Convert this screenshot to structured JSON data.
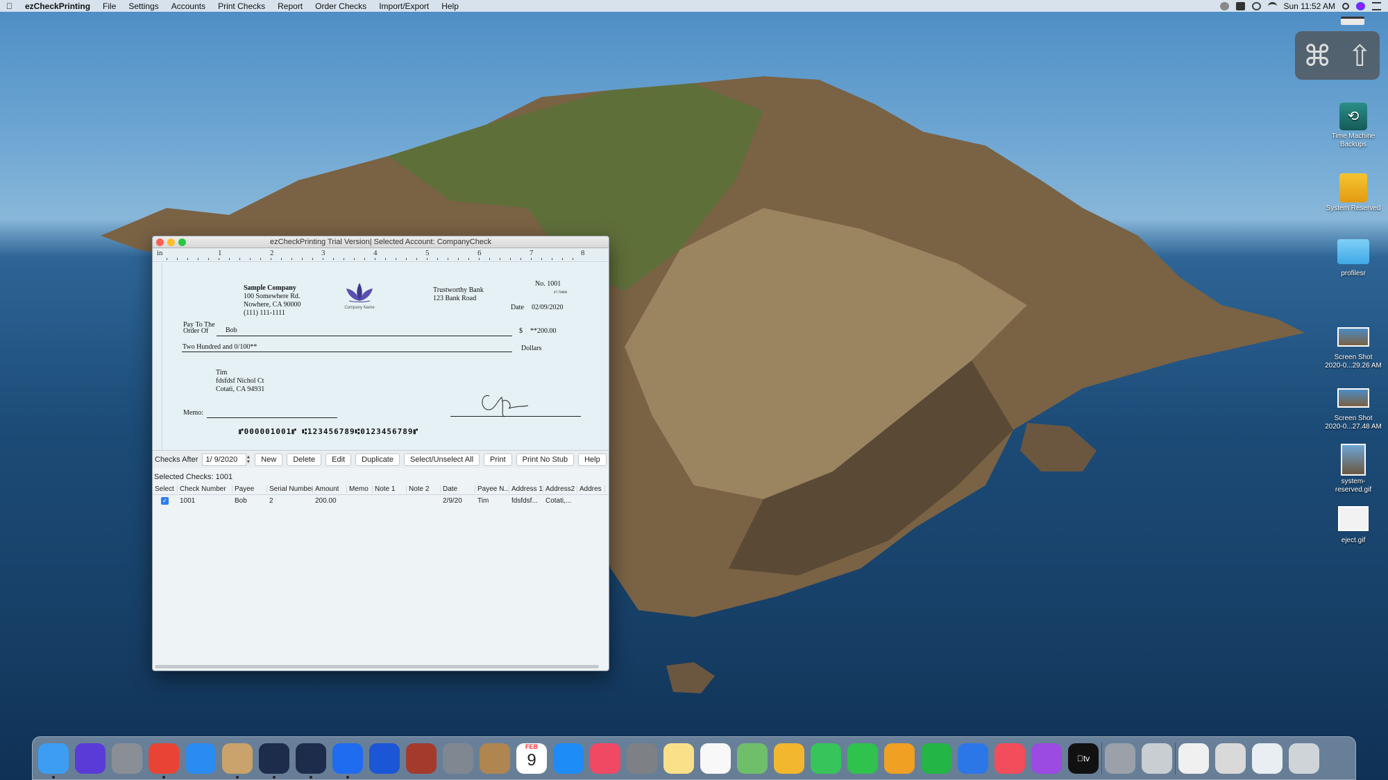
{
  "menubar": {
    "app": "ezCheckPrinting",
    "items": [
      "File",
      "Settings",
      "Accounts",
      "Print Checks",
      "Report",
      "Order Checks",
      "Import/Export",
      "Help"
    ],
    "clock": "Sun 11:52 AM"
  },
  "window": {
    "title": "ezCheckPrinting Trial Version| Selected Account: CompanyCheck",
    "ruler": {
      "unit": "in",
      "marks": [
        "1",
        "2",
        "3",
        "4",
        "5",
        "6",
        "7",
        "8"
      ]
    },
    "check": {
      "company_name": "Sample Company",
      "company_addr1": "100 Somewhere Rd.",
      "company_addr2": "Nowhere, CA 90000",
      "company_phone": "(111) 111-1111",
      "logo_text": "Company Name",
      "bank_name": "Trustworthy Bank",
      "bank_addr": "123 Bank Road",
      "number_label": "No. 1001",
      "fraction": "67-76890",
      "date_label": "Date",
      "date": "02/09/2020",
      "pay_to_label_1": "Pay To The",
      "pay_to_label_2": "Order Of",
      "payee": "Bob",
      "dollar_sign": "$",
      "amount": "**200.00",
      "amount_words": "Two Hundred and 0/100**",
      "dollars_label": "Dollars",
      "addr_name": "Tim",
      "addr_line1": "fdsfdsf Nichol Ct",
      "addr_line2": "Cotati, CA 94931",
      "memo_label": "Memo:",
      "micr": "⑈000001001⑈ ⑆123456789⑆0123456789⑈"
    },
    "toolbar": {
      "checks_after_label": "Checks After",
      "date_value": "1/  9/2020",
      "buttons": [
        "New",
        "Delete",
        "Edit",
        "Duplicate",
        "Select/Unselect All",
        "Print",
        "Print No Stub",
        "Help"
      ]
    },
    "selected_label": "Selected Checks: 1001",
    "table": {
      "columns": [
        "Select",
        "Check Number",
        "Payee",
        "Serial Number",
        "Amount",
        "Memo",
        "Note 1",
        "Note 2",
        "Date",
        "Payee N...",
        "Address 1",
        "Address2",
        "Addres"
      ],
      "rows": [
        {
          "check_number": "1001",
          "payee": "Bob",
          "serial": "2",
          "amount": "200.00",
          "memo": "",
          "note1": "",
          "note2": "",
          "date": "2/9/20",
          "payee_name": "Tim",
          "address1": "fdsfdsf...",
          "address2": "Cotati,...",
          "address3": ""
        }
      ]
    }
  },
  "desktop_icons": [
    {
      "label1": "Time Machine",
      "label2": "Backups"
    },
    {
      "label1": "System Reserved",
      "label2": ""
    },
    {
      "label1": "profilesr",
      "label2": ""
    },
    {
      "label1": "Screen Shot",
      "label2": "2020-0...29.26 AM"
    },
    {
      "label1": "Screen Shot",
      "label2": "2020-0...27.48 AM"
    },
    {
      "label1": "system-",
      "label2": "reserved.gif"
    },
    {
      "label1": "eject.gif",
      "label2": ""
    }
  ],
  "calendar": {
    "month": "FEB",
    "day": "9"
  },
  "dock_icons": [
    "finder",
    "siri",
    "launchpad",
    "chrome",
    "safari",
    "preview-bird",
    "ezcheck-1",
    "ezcheck-2",
    "wps",
    "malwarebytes",
    "dictionary",
    "image-capture",
    "contacts",
    "calendar",
    "app-store",
    "music",
    "system-preferences",
    "notes",
    "reminders",
    "maps",
    "photos",
    "messages",
    "facetime",
    "pages",
    "numbers",
    "keynote",
    "news",
    "podcasts",
    "apple-tv",
    "utility",
    "scanner",
    "file",
    "printer",
    "downloads",
    "trash"
  ]
}
